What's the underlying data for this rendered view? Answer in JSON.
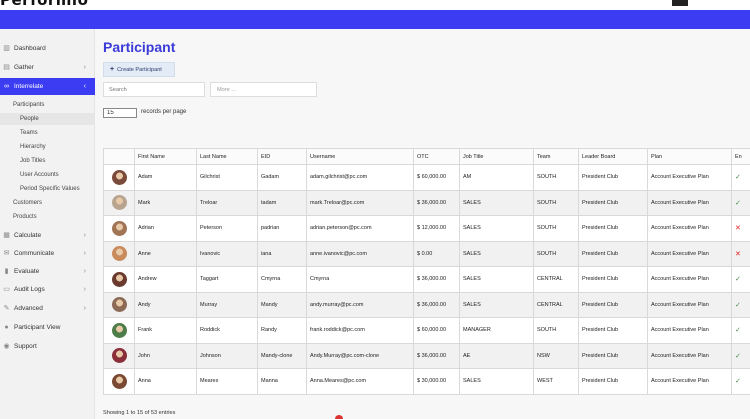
{
  "brand": {
    "logo_text": "Performio"
  },
  "sidebar": {
    "items": [
      {
        "label": "Dashboard",
        "icon": "chart-icon"
      },
      {
        "label": "Gather",
        "icon": "gather-icon"
      },
      {
        "label": "Interrelate",
        "icon": "link-icon",
        "active": true
      },
      {
        "label": "Calculate",
        "icon": "calculator-icon"
      },
      {
        "label": "Communicate",
        "icon": "communicate-icon"
      },
      {
        "label": "Evaluate",
        "icon": "evaluate-icon"
      },
      {
        "label": "Audit Logs",
        "icon": "audit-icon"
      },
      {
        "label": "Advanced",
        "icon": "wrench-icon"
      },
      {
        "label": "Participant View",
        "icon": "user-icon"
      },
      {
        "label": "Support",
        "icon": "support-icon"
      }
    ],
    "interrelate_sub": {
      "participants": "Participants",
      "people": "People",
      "teams": "Teams",
      "hierarchy": "Hierarchy",
      "job_titles": "Job Titles",
      "user_accounts": "User Accounts",
      "period_specific_values": "Period Specific Values",
      "customers": "Customers",
      "products": "Products"
    },
    "active_chevron": "‹",
    "chevron": "›"
  },
  "main": {
    "title": "Participant",
    "create_button": "Create Participant",
    "search_placeholder": "Search",
    "more_label": "More ...",
    "records_per_page_value": "15",
    "records_per_page_label": "records per page",
    "footer": "Showing 1 to 15 of 53 entries"
  },
  "table": {
    "headers": [
      "",
      "First Name",
      "Last Name",
      "EID",
      "Username",
      "OTC",
      "Job Title",
      "Team",
      "Leader Board",
      "Plan",
      "En"
    ],
    "rows": [
      {
        "first": "Adam",
        "last": "Gilchrist",
        "eid": "Gadam",
        "username": "adam.gilchrist@pc.com",
        "otc": "$ 60,000.00",
        "job": "AM",
        "team": "SOUTH",
        "board": "President Club",
        "plan": "Account Executive Plan",
        "enabled": "✓",
        "ok": true,
        "avatar_color": "#7a4b3a"
      },
      {
        "first": "Mark",
        "last": "Treloar",
        "eid": "tadam",
        "username": "mark.Treloar@pc.com",
        "otc": "$ 36,000.00",
        "job": "SALES",
        "team": "SOUTH",
        "board": "President Club",
        "plan": "Account Executive Plan",
        "enabled": "✓",
        "ok": true,
        "avatar_color": "#b9a58f"
      },
      {
        "first": "Adrian",
        "last": "Peterson",
        "eid": "padrian",
        "username": "adrian.peterson@pc.com",
        "otc": "$ 12,000.00",
        "job": "SALES",
        "team": "SOUTH",
        "board": "President Club",
        "plan": "Account Executive Plan",
        "enabled": "✕",
        "ok": false,
        "avatar_color": "#a07455"
      },
      {
        "first": "Anne",
        "last": "Ivanovic",
        "eid": "iana",
        "username": "anne.ivanovic@pc.com",
        "otc": "$ 0.00",
        "job": "SALES",
        "team": "SOUTH",
        "board": "President Club",
        "plan": "Account Executive Plan",
        "enabled": "✕",
        "ok": false,
        "avatar_color": "#c98a5c"
      },
      {
        "first": "Andrew",
        "last": "Taggart",
        "eid": "Cmyrna",
        "username": "Cmyrna",
        "otc": "$ 36,000.00",
        "job": "SALES",
        "team": "CENTRAL",
        "board": "President Club",
        "plan": "Account Executive Plan",
        "enabled": "✓",
        "ok": true,
        "avatar_color": "#6a3b2e"
      },
      {
        "first": "Andy",
        "last": "Murray",
        "eid": "Mandy",
        "username": "andy.murray@pc.com",
        "otc": "$ 36,000.00",
        "job": "SALES",
        "team": "CENTRAL",
        "board": "President Club",
        "plan": "Account Executive Plan",
        "enabled": "✓",
        "ok": true,
        "avatar_color": "#8c6a56"
      },
      {
        "first": "Frank",
        "last": "Roddick",
        "eid": "Randy",
        "username": "frank.roddick@pc.com",
        "otc": "$ 60,000.00",
        "job": "MANAGER",
        "team": "SOUTH",
        "board": "President Club",
        "plan": "Account Executive Plan",
        "enabled": "✓",
        "ok": true,
        "avatar_color": "#4f7d4a"
      },
      {
        "first": "John",
        "last": "Johnson",
        "eid": "Mandy-clone",
        "username": "Andy.Murray@pc.com-clone",
        "otc": "$ 36,000.00",
        "job": "AE",
        "team": "NSW",
        "board": "President Club",
        "plan": "Account Executive Plan",
        "enabled": "✓",
        "ok": true,
        "avatar_color": "#8a2f3a"
      },
      {
        "first": "Anna",
        "last": "Meares",
        "eid": "Manna",
        "username": "Anna.Meares@pc.com",
        "otc": "$ 30,000.00",
        "job": "SALES",
        "team": "WEST",
        "board": "President Club",
        "plan": "Account Executive Plan",
        "enabled": "✓",
        "ok": true,
        "avatar_color": "#7b4a33"
      }
    ]
  },
  "colors": {
    "accent": "#3c3cf2",
    "title": "#3a3ad8",
    "check": "#4a8a4a",
    "cross": "#dd2222"
  }
}
